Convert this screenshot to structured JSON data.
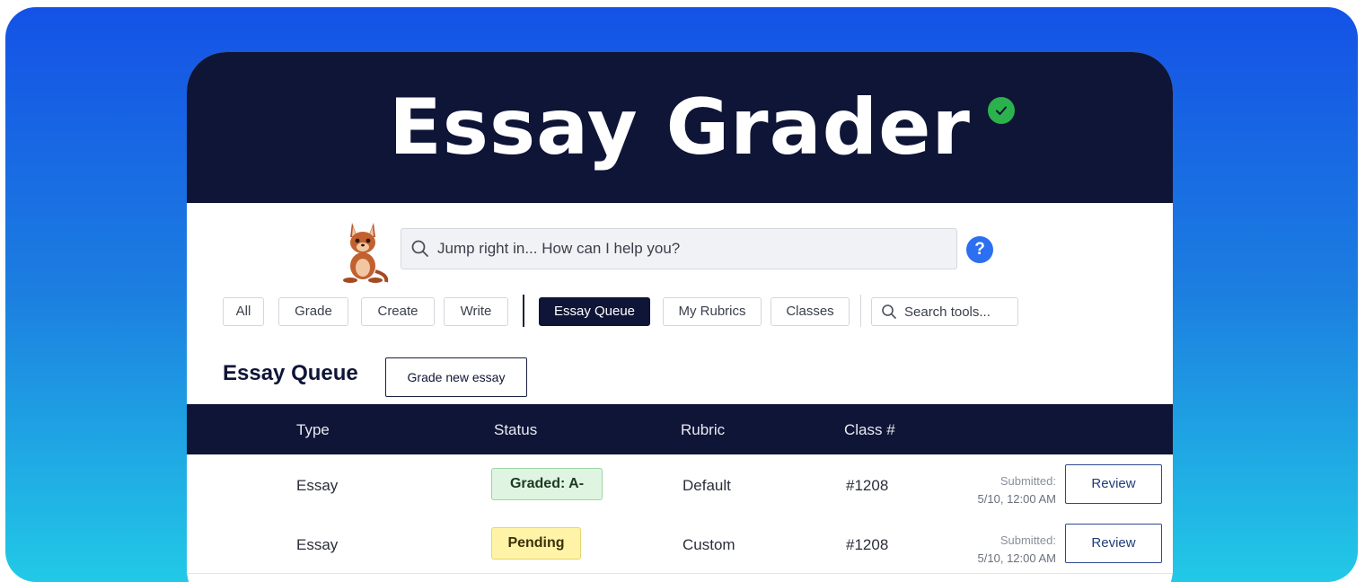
{
  "header": {
    "title": "Essay Grader",
    "verified_icon": "check-circle-icon"
  },
  "search": {
    "placeholder": "Jump right in... How can I help you?"
  },
  "help_label": "?",
  "filters": [
    {
      "label": "All",
      "active": false
    },
    {
      "label": "Grade",
      "active": false
    },
    {
      "label": "Create",
      "active": false
    },
    {
      "label": "Write",
      "active": false
    },
    {
      "label": "Essay Queue",
      "active": true
    },
    {
      "label": "My Rubrics",
      "active": false
    },
    {
      "label": "Classes",
      "active": false
    }
  ],
  "tool_search": {
    "placeholder": "Search tools..."
  },
  "queue": {
    "title": "Essay Queue",
    "grade_button": "Grade new essay",
    "columns": [
      "Type",
      "Status",
      "Rubric",
      "Class #"
    ],
    "rows": [
      {
        "type": "Essay",
        "status": "Graded: A-",
        "status_kind": "graded",
        "rubric": "Default",
        "class": "#1208",
        "submitted_label": "Submitted:",
        "submitted_date": "5/10, 12:00 AM",
        "action": "Review"
      },
      {
        "type": "Essay",
        "status": "Pending",
        "status_kind": "pending",
        "rubric": "Custom",
        "class": "#1208",
        "submitted_label": "Submitted:",
        "submitted_date": "5/10, 12:00 AM",
        "action": "Review"
      }
    ]
  },
  "colors": {
    "navy": "#0f1536",
    "gradient_top": "#1452e6",
    "gradient_bottom": "#22c9e6",
    "graded_bg": "#dff5e1",
    "graded_border": "#9ed3a6",
    "pending_bg": "#fff3a8",
    "pending_border": "#e8d56a",
    "help_blue": "#2c6ff0",
    "verified_green": "#2bb24c"
  }
}
